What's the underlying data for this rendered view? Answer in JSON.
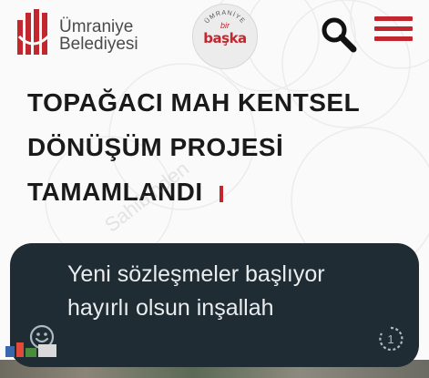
{
  "header": {
    "brand_line1": "Ümraniye",
    "brand_line2": "Belediyesi",
    "badge_top": "ÜMRANİYE",
    "badge_small": "bir",
    "badge_main": "başka"
  },
  "headline": {
    "lines": [
      "TOPAĞACI MAH KENTSEL",
      "DÖNÜŞÜM PROJESİ",
      "TAMAMLANDI"
    ]
  },
  "watermark": "Sahibinden",
  "message": {
    "text": "Yeni sözleşmeler başlıyor hayırlı olsun inşallah",
    "counter": "1"
  },
  "colors": {
    "brand_red": "#c1272d",
    "bubble_bg": "#202c33",
    "bubble_text": "#e9edef"
  },
  "icons": [
    "ataturk-mark-icon",
    "search-icon",
    "hamburger-menu-icon",
    "emoji-icon",
    "view-once-icon"
  ]
}
